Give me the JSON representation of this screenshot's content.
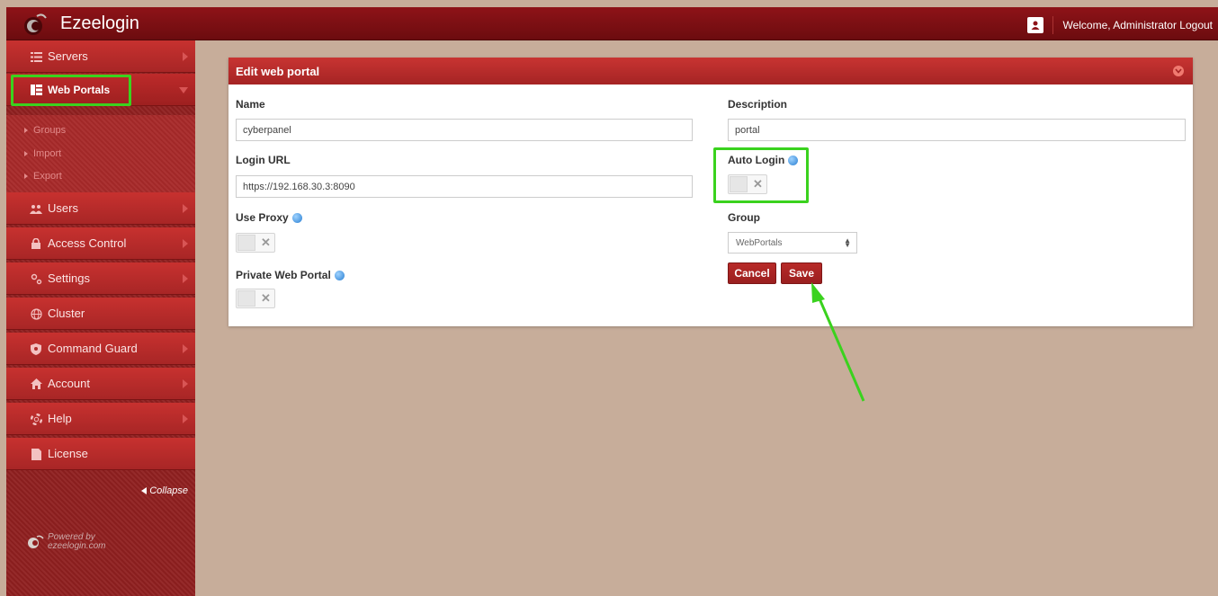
{
  "app": {
    "title": "Ezeelogin",
    "welcome": "Welcome, Administrator",
    "logout": "Logout"
  },
  "sidebar": {
    "items": [
      {
        "label": "Servers",
        "icon": "list-icon"
      },
      {
        "label": "Web Portals",
        "icon": "web-portal-icon"
      },
      {
        "label": "Users",
        "icon": "users-icon"
      },
      {
        "label": "Access Control",
        "icon": "lock-icon"
      },
      {
        "label": "Settings",
        "icon": "gears-icon"
      },
      {
        "label": "Cluster",
        "icon": "globe-icon"
      },
      {
        "label": "Command Guard",
        "icon": "shield-icon"
      },
      {
        "label": "Account",
        "icon": "home-icon"
      },
      {
        "label": "Help",
        "icon": "lifebuoy-icon"
      },
      {
        "label": "License",
        "icon": "document-icon"
      }
    ],
    "subitems": [
      "Groups",
      "Import",
      "Export"
    ],
    "collapse": "Collapse",
    "powered_by": "Powered by",
    "powered_site": "ezeelogin.com"
  },
  "panel": {
    "title": "Edit web portal",
    "name_label": "Name",
    "name_value": "cyberpanel",
    "description_label": "Description",
    "description_value": "portal",
    "login_url_label": "Login URL",
    "login_url_value": "https://192.168.30.3:8090",
    "auto_login_label": "Auto Login",
    "use_proxy_label": "Use Proxy",
    "group_label": "Group",
    "group_value": "WebPortals",
    "private_label": "Private Web Portal",
    "cancel": "Cancel",
    "save": "Save",
    "toggle_off_symbol": "✕"
  },
  "colors": {
    "accent": "#b02828",
    "highlight": "#3ad21e"
  }
}
